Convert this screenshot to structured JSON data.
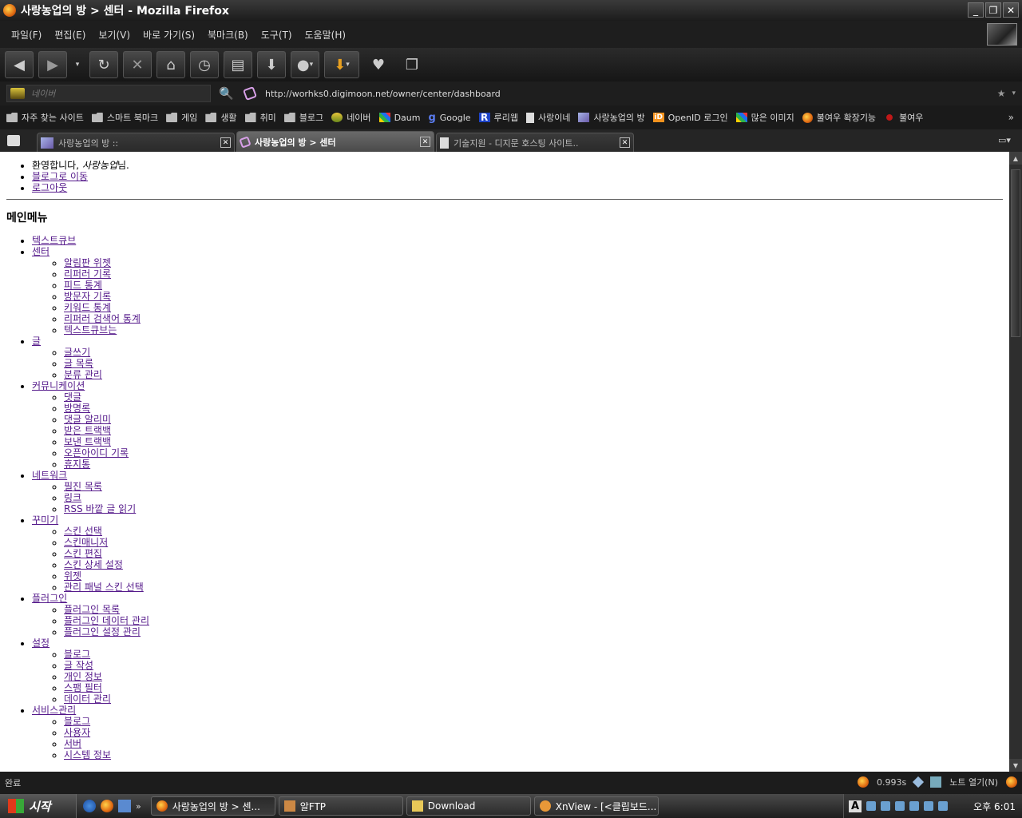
{
  "window": {
    "title": "사랑농업의 방 > 센터 - Mozilla Firefox",
    "controls": [
      "_",
      "❐",
      "✕"
    ]
  },
  "menubar": {
    "items": [
      "파일(F)",
      "편집(E)",
      "보기(V)",
      "바로 가기(S)",
      "북마크(B)",
      "도구(T)",
      "도움말(H)"
    ]
  },
  "toolbar": {
    "back": "◀",
    "forward": "▶",
    "history_drop": "▾",
    "reload": "↻",
    "stop": "✕",
    "home": "⌂",
    "history": "◷",
    "bookmarks": "▤",
    "download": "⬇",
    "extra_drop": "▾",
    "addon_drop": "▾"
  },
  "search": {
    "placeholder": "네이버",
    "go_icon": "🔍"
  },
  "address": {
    "url": "http://worhks0.digimoon.net/owner/center/dashboard",
    "star": "★",
    "dropdown": "▾"
  },
  "bookmarks": {
    "items": [
      {
        "label": "자주 찾는 사이트",
        "icon": "folder"
      },
      {
        "label": "스마트 북마크",
        "icon": "folder"
      },
      {
        "label": "게임",
        "icon": "folder"
      },
      {
        "label": "생활",
        "icon": "folder"
      },
      {
        "label": "취미",
        "icon": "folder"
      },
      {
        "label": "블로그",
        "icon": "folder"
      },
      {
        "label": "네이버",
        "icon": "naver"
      },
      {
        "label": "Daum",
        "icon": "daum"
      },
      {
        "label": "Google",
        "icon": "google"
      },
      {
        "label": "루리웹",
        "icon": "r"
      },
      {
        "label": "사랑이네",
        "icon": "page"
      },
      {
        "label": "사랑농업의 방",
        "icon": "girl"
      },
      {
        "label": "OpenID 로그인",
        "icon": "openid"
      },
      {
        "label": "많은 이미지",
        "icon": "daum"
      },
      {
        "label": "불여우 확장기능",
        "icon": "ff"
      },
      {
        "label": "불여우",
        "icon": "flower"
      }
    ],
    "more": "»"
  },
  "tabs": {
    "items": [
      {
        "label": "사랑농업의 방 ::",
        "active": false
      },
      {
        "label": "사랑농업의 방 > 센터",
        "active": true
      },
      {
        "label": "기술지원 - 디지문 호스팅 사이트..",
        "active": false
      }
    ],
    "close": "✕",
    "list_btn": "▾"
  },
  "content": {
    "welcome": {
      "prefix": "환영합니다, ",
      "user": "사랑농업",
      "suffix": "님."
    },
    "links": {
      "blog": "블로그로 이동",
      "logout": "로그아웃"
    },
    "main_menu_title": "메인메뉴",
    "menu": [
      {
        "label": "텍스트큐브",
        "children": []
      },
      {
        "label": "센터",
        "children": [
          "알림판 위젯",
          "리퍼러 기록",
          "피드 통계",
          "방문자 기록",
          "키워드 통계",
          "리퍼러 검색어 통계",
          "텍스트큐브는"
        ]
      },
      {
        "label": "글",
        "children": [
          "글쓰기",
          "글 목록",
          "분류 관리"
        ]
      },
      {
        "label": "커뮤니케이션",
        "children": [
          "댓글",
          "방명록",
          "댓글 알리미",
          "받은 트랙백",
          "보낸 트랙백",
          "오픈아이디 기록",
          "휴지통"
        ]
      },
      {
        "label": "네트워크",
        "children": [
          "필진 목록",
          "링크",
          "RSS 바깥 글 읽기"
        ]
      },
      {
        "label": "꾸미기",
        "children": [
          "스킨 선택",
          "스킨매니저",
          "스킨 편집",
          "스킨 상세 설정",
          "위젯",
          "관리 패널 스킨 선택"
        ]
      },
      {
        "label": "플러그인",
        "children": [
          "플러그인 목록",
          "플러그인 데이터 관리",
          "플러그인 설정 관리"
        ]
      },
      {
        "label": "설정",
        "children": [
          "블로그",
          "글 작성",
          "개인 정보",
          "스팸 필터",
          "데이터 관리"
        ]
      },
      {
        "label": "서비스관리",
        "children": [
          "블로그",
          "사용자",
          "서버",
          "시스템 정보"
        ]
      }
    ]
  },
  "scrollbar": {
    "up": "▲",
    "down": "▼"
  },
  "statusbar": {
    "text": "완료",
    "timing": "0.993s",
    "note_label": "노트 열기(N)"
  },
  "taskbar": {
    "start": "시작",
    "ql_more": "»",
    "buttons": [
      {
        "label": "사랑농업의 방 > 센...",
        "icon": "ff",
        "active": true
      },
      {
        "label": "알FTP",
        "icon": "ftp",
        "active": false
      },
      {
        "label": "Download",
        "icon": "folder",
        "active": false
      },
      {
        "label": "XnView - [<클립보드...",
        "icon": "xn",
        "active": false
      }
    ],
    "ime": "A",
    "clock": "오후 6:01"
  }
}
